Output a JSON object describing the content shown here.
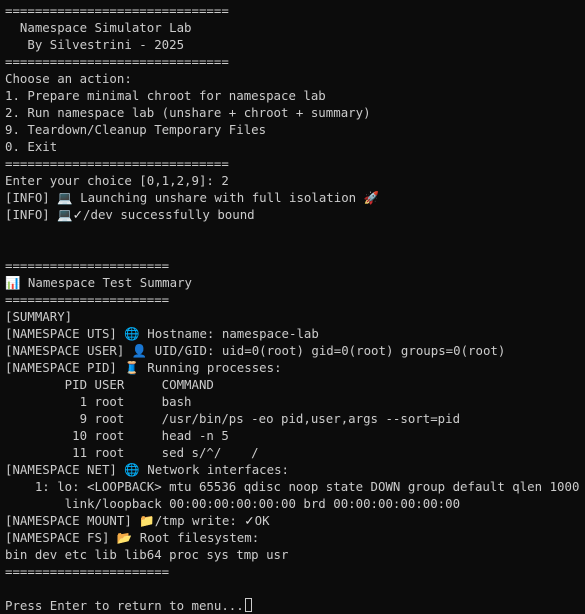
{
  "terminal": {
    "lines": {
      "l0": "==============================",
      "l1": "  Namespace Simulator Lab",
      "l2": "   By Silvestrini - 2025",
      "l3": "==============================",
      "l4": "Choose an action:",
      "l5": "1. Prepare minimal chroot for namespace lab",
      "l6": "2. Run namespace lab (unshare + chroot + summary)",
      "l7": "9. Teardown/Cleanup Temporary Files",
      "l8": "0. Exit",
      "l9": "==============================",
      "l10": "Enter your choice [0,1,2,9]: 2",
      "l11_prefix": "[INFO] ",
      "l11_text": " Launching unshare with full isolation ",
      "l12_prefix": "[INFO] ",
      "l12_text": "/dev successfully bound",
      "l15": "======================",
      "l16_text": " Namespace Test Summary",
      "l17": "======================",
      "l18": "[SUMMARY]",
      "l19_prefix": "[NAMESPACE UTS] ",
      "l19_text": " Hostname: namespace-lab",
      "l20_prefix": "[NAMESPACE USER] ",
      "l20_text": " UID/GID: uid=0(root) gid=0(root) groups=0(root)",
      "l21_prefix": "[NAMESPACE PID] ",
      "l21_text": " Running processes:",
      "l22": "        PID USER     COMMAND",
      "l23": "          1 root     bash",
      "l24": "          9 root     /usr/bin/ps -eo pid,user,args --sort=pid",
      "l25": "         10 root     head -n 5",
      "l26": "         11 root     sed s/^/    /",
      "l27_prefix": "[NAMESPACE NET] ",
      "l27_text": " Network interfaces:",
      "l28": "    1: lo: <LOOPBACK> mtu 65536 qdisc noop state DOWN group default qlen 1000",
      "l29": "        link/loopback 00:00:00:00:00:00 brd 00:00:00:00:00:00",
      "l30_prefix": "[NAMESPACE MOUNT] ",
      "l30_text": "/tmp write: ",
      "l30_ok": "OK",
      "l31_prefix": "[NAMESPACE FS] ",
      "l31_text": " Root filesystem:",
      "l32": "bin dev etc lib lib64 proc sys tmp usr",
      "l33": "======================",
      "l35": "Press Enter to return to menu..."
    },
    "icons": {
      "laptop": "💻",
      "check": "✓",
      "rocket": "🚀",
      "chart": "📊",
      "globe": "🌐",
      "person": "👤",
      "spool": "🧵",
      "folder_open": "📁",
      "folder": "📂"
    },
    "colors": {
      "background": "#0c0c0c",
      "foreground": "#cccccc"
    }
  }
}
